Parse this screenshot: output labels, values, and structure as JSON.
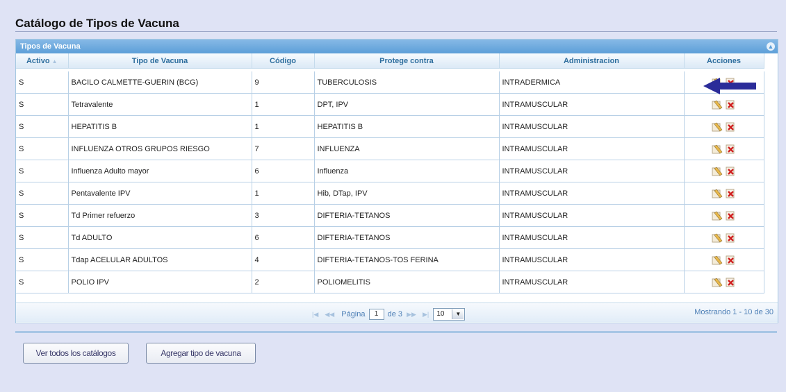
{
  "page": {
    "title": "Catálogo de Tipos de Vacuna"
  },
  "grid": {
    "caption": "Tipos de Vacuna",
    "columns": {
      "activo": "Activo",
      "tipo": "Tipo de Vacuna",
      "codigo": "Código",
      "protege": "Protege contra",
      "admin": "Administracion",
      "acciones": "Acciones"
    },
    "rows": [
      {
        "activo": "S",
        "tipo": "BACILO CALMETTE-GUERIN (BCG)",
        "codigo": "9",
        "protege": "TUBERCULOSIS",
        "admin": "INTRADERMICA"
      },
      {
        "activo": "S",
        "tipo": "Tetravalente",
        "codigo": "1",
        "protege": "DPT, IPV",
        "admin": "INTRAMUSCULAR"
      },
      {
        "activo": "S",
        "tipo": "HEPATITIS B",
        "codigo": "1",
        "protege": "HEPATITIS B",
        "admin": "INTRAMUSCULAR"
      },
      {
        "activo": "S",
        "tipo": "INFLUENZA OTROS GRUPOS RIESGO",
        "codigo": "7",
        "protege": "INFLUENZA",
        "admin": "INTRAMUSCULAR"
      },
      {
        "activo": "S",
        "tipo": "Influenza Adulto mayor",
        "codigo": "6",
        "protege": "Influenza",
        "admin": "INTRAMUSCULAR"
      },
      {
        "activo": "S",
        "tipo": "Pentavalente IPV",
        "codigo": "1",
        "protege": "Hib, DTap, IPV",
        "admin": "INTRAMUSCULAR"
      },
      {
        "activo": "S",
        "tipo": "Td Primer refuerzo",
        "codigo": "3",
        "protege": "DIFTERIA-TETANOS",
        "admin": "INTRAMUSCULAR"
      },
      {
        "activo": "S",
        "tipo": "Td ADULTO",
        "codigo": "6",
        "protege": "DIFTERIA-TETANOS",
        "admin": "INTRAMUSCULAR"
      },
      {
        "activo": "S",
        "tipo": "Tdap ACELULAR ADULTOS",
        "codigo": "4",
        "protege": "DIFTERIA-TETANOS-TOS FERINA",
        "admin": "INTRAMUSCULAR"
      },
      {
        "activo": "S",
        "tipo": "POLIO IPV",
        "codigo": "2",
        "protege": "POLIOMELITIS",
        "admin": "INTRAMUSCULAR"
      }
    ],
    "icons": {
      "edit": "edit-pencil-icon",
      "delete": "delete-icon",
      "sort": "sort-icon",
      "collapse": "collapse-icon"
    }
  },
  "pager": {
    "page_label": "Página",
    "page_value": "1",
    "of_label": "de 3",
    "rows_per_page": "10",
    "record_info": "Mostrando 1 - 10 de 30"
  },
  "buttons": {
    "view_all": "Ver todos los catálogos",
    "add": "Agregar tipo de vacuna"
  },
  "colors": {
    "arrow": "#2b2c99",
    "header_text": "#2e6e9e",
    "caption": "#5d9fd8"
  }
}
